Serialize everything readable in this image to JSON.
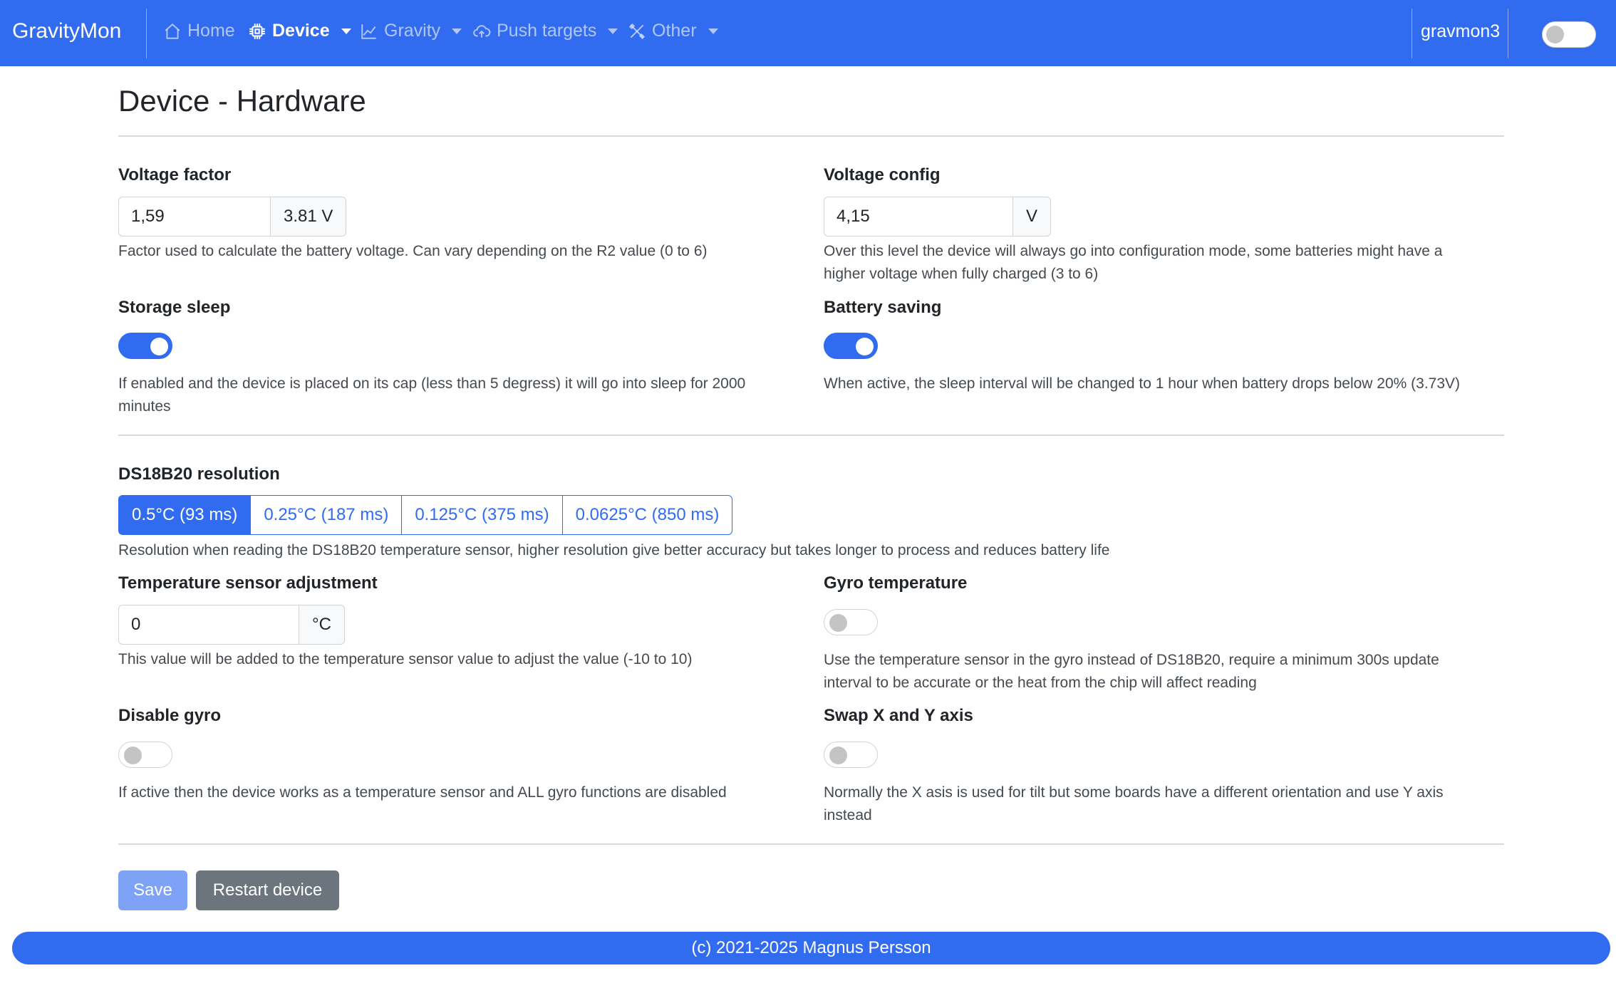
{
  "navbar": {
    "brand": "GravityMon",
    "items": [
      {
        "label": "Home",
        "icon": "house-icon",
        "active": false,
        "dropdown": false
      },
      {
        "label": "Device",
        "icon": "cpu-icon",
        "active": true,
        "dropdown": true
      },
      {
        "label": "Gravity",
        "icon": "graph-up-icon",
        "active": false,
        "dropdown": true
      },
      {
        "label": "Push targets",
        "icon": "cloud-upload-icon",
        "active": false,
        "dropdown": true
      },
      {
        "label": "Other",
        "icon": "tools-icon",
        "active": false,
        "dropdown": true
      }
    ],
    "hostname": "gravmon3",
    "dark_mode_on": false
  },
  "page": {
    "title": "Device - Hardware"
  },
  "voltage_factor": {
    "label": "Voltage factor",
    "value": "1,59",
    "addon": "3.81 V",
    "help": "Factor used to calculate the battery voltage. Can vary depending on the R2 value (0 to 6)"
  },
  "voltage_config": {
    "label": "Voltage config",
    "value": "4,15",
    "addon": "V",
    "help": "Over this level the device will always go into configuration mode, some batteries might have a higher voltage when fully charged (3 to 6)"
  },
  "storage_sleep": {
    "label": "Storage sleep",
    "enabled": true,
    "help": "If enabled and the device is placed on its cap (less than 5 degress) it will go into sleep for 2000 minutes"
  },
  "battery_saving": {
    "label": "Battery saving",
    "enabled": true,
    "help": "When active, the sleep interval will be changed to 1 hour when battery drops below 20% (3.73V)"
  },
  "ds18b20": {
    "label": "DS18B20 resolution",
    "options": [
      "0.5°C (93 ms)",
      "0.25°C (187 ms)",
      "0.125°C (375 ms)",
      "0.0625°C (850 ms)"
    ],
    "selected": 0,
    "help": "Resolution when reading the DS18B20 temperature sensor, higher resolution give better accuracy but takes longer to process and reduces battery life"
  },
  "temp_adjust": {
    "label": "Temperature sensor adjustment",
    "value": "0",
    "addon": "°C",
    "help": "This value will be added to the temperature sensor value to adjust the value (-10 to 10)"
  },
  "gyro_temp": {
    "label": "Gyro temperature",
    "enabled": false,
    "help": "Use the temperature sensor in the gyro instead of DS18B20, require a minimum 300s update interval to be accurate or the heat from the chip will affect reading"
  },
  "disable_gyro": {
    "label": "Disable gyro",
    "enabled": false,
    "help": "If active then the device works as a temperature sensor and ALL gyro functions are disabled"
  },
  "swap_axis": {
    "label": "Swap X and Y axis",
    "enabled": false,
    "help": "Normally the X asis is used for tilt but some boards have a different orientation and use Y axis instead"
  },
  "buttons": {
    "save": "Save",
    "restart": "Restart device"
  },
  "footer": {
    "text": "(c) 2021-2025 Magnus Persson"
  },
  "colors": {
    "primary": "#316bf0",
    "secondary": "#6c757d",
    "save_disabled": "#7ea2f5"
  }
}
